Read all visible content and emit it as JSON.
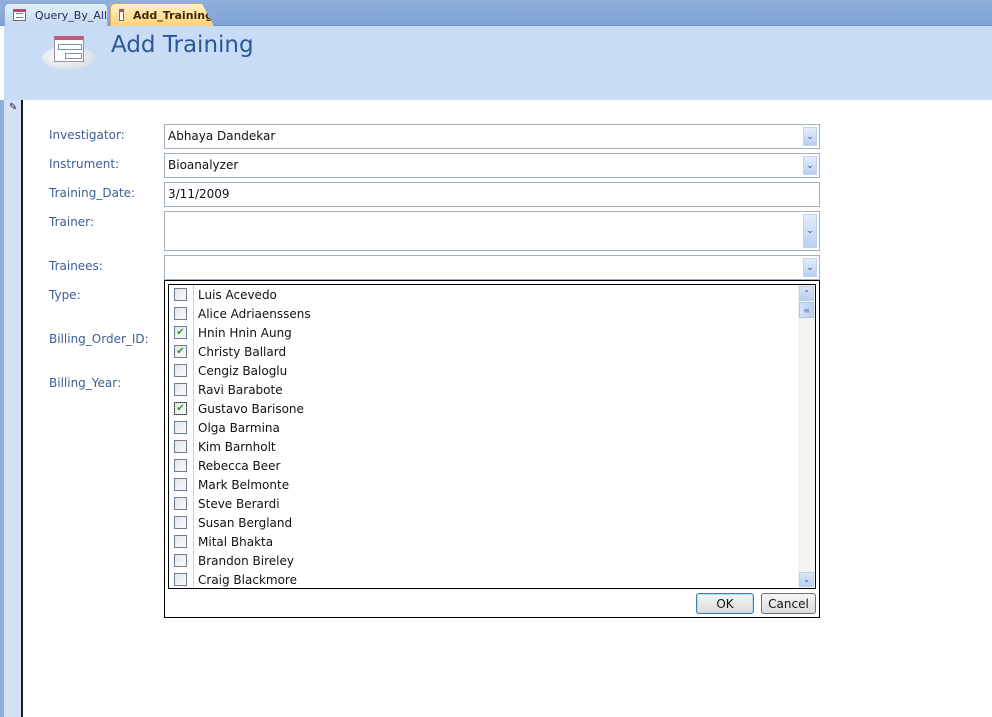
{
  "tabs": [
    {
      "label": "Query_By_All",
      "icon": "form-icon",
      "active": false
    },
    {
      "label": "Add_Training",
      "icon": "form-icon",
      "active": true
    }
  ],
  "header": {
    "title": "Add Training",
    "icon": "form-icon"
  },
  "record_selector": {
    "icon": "pencil-icon",
    "glyph": "✎"
  },
  "form": {
    "labels": {
      "investigator": "Investigator:",
      "instrument": "Instrument:",
      "training_date": "Training_Date:",
      "trainer": "Trainer:",
      "trainees": "Trainees:",
      "type": "Type:",
      "billing_order_id": "Billing_Order_ID:",
      "billing_year": "Billing_Year:"
    },
    "values": {
      "investigator": "Abhaya Dandekar",
      "instrument": "Bioanalyzer",
      "training_date": "3/11/2009",
      "trainer": "",
      "trainees": ""
    }
  },
  "trainees_list": {
    "items": [
      {
        "name": "Luis Acevedo",
        "checked": false
      },
      {
        "name": "Alice Adriaenssens",
        "checked": false
      },
      {
        "name": "Hnin Hnin Aung",
        "checked": true
      },
      {
        "name": "Christy Ballard",
        "checked": true
      },
      {
        "name": "Cengiz Baloglu",
        "checked": false
      },
      {
        "name": "Ravi Barabote",
        "checked": false
      },
      {
        "name": "Gustavo Barisone",
        "checked": true,
        "focused": true
      },
      {
        "name": "Olga Barmina",
        "checked": false
      },
      {
        "name": "Kim Barnholt",
        "checked": false
      },
      {
        "name": "Rebecca Beer",
        "checked": false
      },
      {
        "name": "Mark Belmonte",
        "checked": false
      },
      {
        "name": "Steve Berardi",
        "checked": false
      },
      {
        "name": "Susan Bergland",
        "checked": false
      },
      {
        "name": "Mital Bhakta",
        "checked": false
      },
      {
        "name": "Brandon Bireley",
        "checked": false
      },
      {
        "name": "Craig Blackmore",
        "checked": false
      }
    ],
    "check_glyph": "✔",
    "ok_label": "OK",
    "cancel_label": "Cancel"
  },
  "icons": {
    "chevron_down": "⌄",
    "chevron_up": "⌃",
    "thumb_grip": "≡"
  }
}
